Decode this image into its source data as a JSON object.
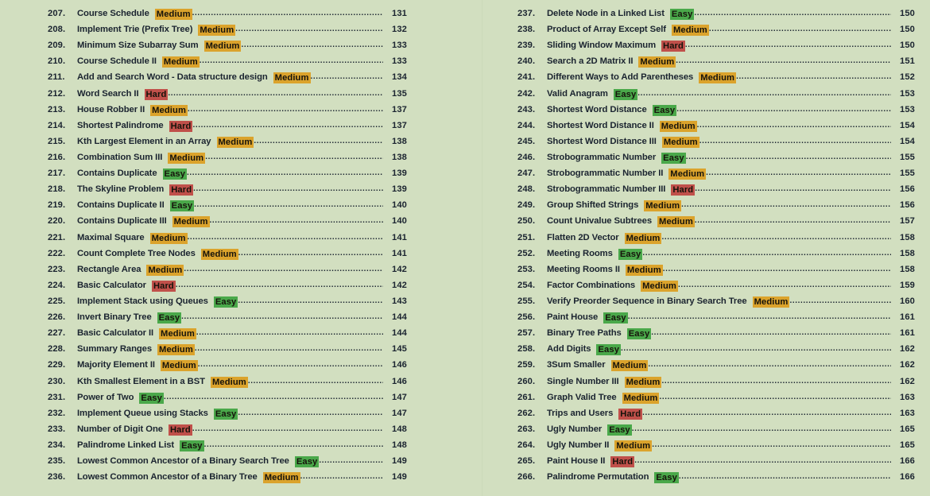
{
  "document": {
    "kind": "table-of-contents",
    "background_color": "#d2dfc0",
    "text_color": "#1b2430"
  },
  "difficulty_colors": {
    "easy": "#4aa84a",
    "medium": "#dba32c",
    "hard": "#c0504a"
  },
  "columns": [
    {
      "name": "left-column",
      "entries": [
        {
          "num": "207.",
          "title": "Course Schedule",
          "difficulty": "Medium",
          "page": "131"
        },
        {
          "num": "208.",
          "title": "Implement Trie (Prefix Tree)",
          "difficulty": "Medium",
          "page": "132"
        },
        {
          "num": "209.",
          "title": "Minimum Size Subarray Sum",
          "difficulty": "Medium",
          "page": "133"
        },
        {
          "num": "210.",
          "title": "Course Schedule II",
          "difficulty": "Medium",
          "page": "133"
        },
        {
          "num": "211.",
          "title": "Add and Search Word - Data structure design",
          "difficulty": "Medium",
          "page": "134"
        },
        {
          "num": "212.",
          "title": "Word Search II",
          "difficulty": "Hard",
          "page": "135"
        },
        {
          "num": "213.",
          "title": "House Robber II",
          "difficulty": "Medium",
          "page": "137"
        },
        {
          "num": "214.",
          "title": "Shortest Palindrome",
          "difficulty": "Hard",
          "page": "137"
        },
        {
          "num": "215.",
          "title": "Kth Largest Element in an Array",
          "difficulty": "Medium",
          "page": "138"
        },
        {
          "num": "216.",
          "title": "Combination Sum III",
          "difficulty": "Medium",
          "page": "138"
        },
        {
          "num": "217.",
          "title": "Contains Duplicate",
          "difficulty": "Easy",
          "page": "139"
        },
        {
          "num": "218.",
          "title": "The Skyline Problem",
          "difficulty": "Hard",
          "page": "139"
        },
        {
          "num": "219.",
          "title": "Contains Duplicate II",
          "difficulty": "Easy",
          "page": "140"
        },
        {
          "num": "220.",
          "title": "Contains Duplicate III",
          "difficulty": "Medium",
          "page": "140"
        },
        {
          "num": "221.",
          "title": "Maximal Square",
          "difficulty": "Medium",
          "page": "141"
        },
        {
          "num": "222.",
          "title": "Count Complete Tree Nodes",
          "difficulty": "Medium",
          "page": "141"
        },
        {
          "num": "223.",
          "title": "Rectangle Area",
          "difficulty": "Medium",
          "page": "142"
        },
        {
          "num": "224.",
          "title": "Basic Calculator",
          "difficulty": "Hard",
          "page": "142"
        },
        {
          "num": "225.",
          "title": "Implement Stack using Queues",
          "difficulty": "Easy",
          "page": "143"
        },
        {
          "num": "226.",
          "title": "Invert Binary Tree",
          "difficulty": "Easy",
          "page": "144"
        },
        {
          "num": "227.",
          "title": "Basic Calculator II",
          "difficulty": "Medium",
          "page": "144"
        },
        {
          "num": "228.",
          "title": "Summary Ranges",
          "difficulty": "Medium",
          "page": "145"
        },
        {
          "num": "229.",
          "title": "Majority Element II",
          "difficulty": "Medium",
          "page": "146"
        },
        {
          "num": "230.",
          "title": "Kth Smallest Element in a BST",
          "difficulty": "Medium",
          "page": "146"
        },
        {
          "num": "231.",
          "title": "Power of Two",
          "difficulty": "Easy",
          "page": "147"
        },
        {
          "num": "232.",
          "title": "Implement Queue using Stacks",
          "difficulty": "Easy",
          "page": "147"
        },
        {
          "num": "233.",
          "title": "Number of Digit One",
          "difficulty": "Hard",
          "page": "148"
        },
        {
          "num": "234.",
          "title": "Palindrome Linked List",
          "difficulty": "Easy",
          "page": "148"
        },
        {
          "num": "235.",
          "title": "Lowest Common Ancestor of a Binary Search Tree",
          "difficulty": "Easy",
          "page": "149"
        },
        {
          "num": "236.",
          "title": "Lowest Common Ancestor of a Binary Tree",
          "difficulty": "Medium",
          "page": "149"
        }
      ]
    },
    {
      "name": "right-column",
      "entries": [
        {
          "num": "237.",
          "title": "Delete Node in a Linked List",
          "difficulty": "Easy",
          "page": "150"
        },
        {
          "num": "238.",
          "title": "Product of Array Except Self",
          "difficulty": "Medium",
          "page": "150"
        },
        {
          "num": "239.",
          "title": "Sliding Window Maximum",
          "difficulty": "Hard",
          "page": "150"
        },
        {
          "num": "240.",
          "title": "Search a 2D Matrix II",
          "difficulty": "Medium",
          "page": "151"
        },
        {
          "num": "241.",
          "title": "Different Ways to Add Parentheses",
          "difficulty": "Medium",
          "page": "152"
        },
        {
          "num": "242.",
          "title": "Valid Anagram",
          "difficulty": "Easy",
          "page": "153"
        },
        {
          "num": "243.",
          "title": "Shortest Word Distance",
          "difficulty": "Easy",
          "page": "153"
        },
        {
          "num": "244.",
          "title": "Shortest Word Distance II",
          "difficulty": "Medium",
          "page": "154"
        },
        {
          "num": "245.",
          "title": "Shortest Word Distance III",
          "difficulty": "Medium",
          "page": "154"
        },
        {
          "num": "246.",
          "title": "Strobogrammatic Number",
          "difficulty": "Easy",
          "page": "155"
        },
        {
          "num": "247.",
          "title": "Strobogrammatic Number II",
          "difficulty": "Medium",
          "page": "155"
        },
        {
          "num": "248.",
          "title": "Strobogrammatic Number III",
          "difficulty": "Hard",
          "page": "156"
        },
        {
          "num": "249.",
          "title": "Group Shifted Strings",
          "difficulty": "Medium",
          "page": "156"
        },
        {
          "num": "250.",
          "title": "Count Univalue Subtrees",
          "difficulty": "Medium",
          "page": "157"
        },
        {
          "num": "251.",
          "title": "Flatten 2D Vector",
          "difficulty": "Medium",
          "page": "158"
        },
        {
          "num": "252.",
          "title": "Meeting Rooms",
          "difficulty": "Easy",
          "page": "158"
        },
        {
          "num": "253.",
          "title": "Meeting Rooms II",
          "difficulty": "Medium",
          "page": "158"
        },
        {
          "num": "254.",
          "title": "Factor Combinations",
          "difficulty": "Medium",
          "page": "159"
        },
        {
          "num": "255.",
          "title": "Verify Preorder Sequence in Binary Search Tree",
          "difficulty": "Medium",
          "page": "160"
        },
        {
          "num": "256.",
          "title": "Paint House",
          "difficulty": "Easy",
          "page": "161"
        },
        {
          "num": "257.",
          "title": "Binary Tree Paths",
          "difficulty": "Easy",
          "page": "161"
        },
        {
          "num": "258.",
          "title": "Add Digits",
          "difficulty": "Easy",
          "page": "162"
        },
        {
          "num": "259.",
          "title": "3Sum Smaller",
          "difficulty": "Medium",
          "page": "162"
        },
        {
          "num": "260.",
          "title": "Single Number III",
          "difficulty": "Medium",
          "page": "162"
        },
        {
          "num": "261.",
          "title": "Graph Valid Tree",
          "difficulty": "Medium",
          "page": "163"
        },
        {
          "num": "262.",
          "title": "Trips and Users",
          "difficulty": "Hard",
          "page": "163"
        },
        {
          "num": "263.",
          "title": "Ugly Number",
          "difficulty": "Easy",
          "page": "165"
        },
        {
          "num": "264.",
          "title": "Ugly Number II",
          "difficulty": "Medium",
          "page": "165"
        },
        {
          "num": "265.",
          "title": "Paint House II",
          "difficulty": "Hard",
          "page": "166"
        },
        {
          "num": "266.",
          "title": "Palindrome Permutation",
          "difficulty": "Easy",
          "page": "166"
        }
      ]
    }
  ]
}
